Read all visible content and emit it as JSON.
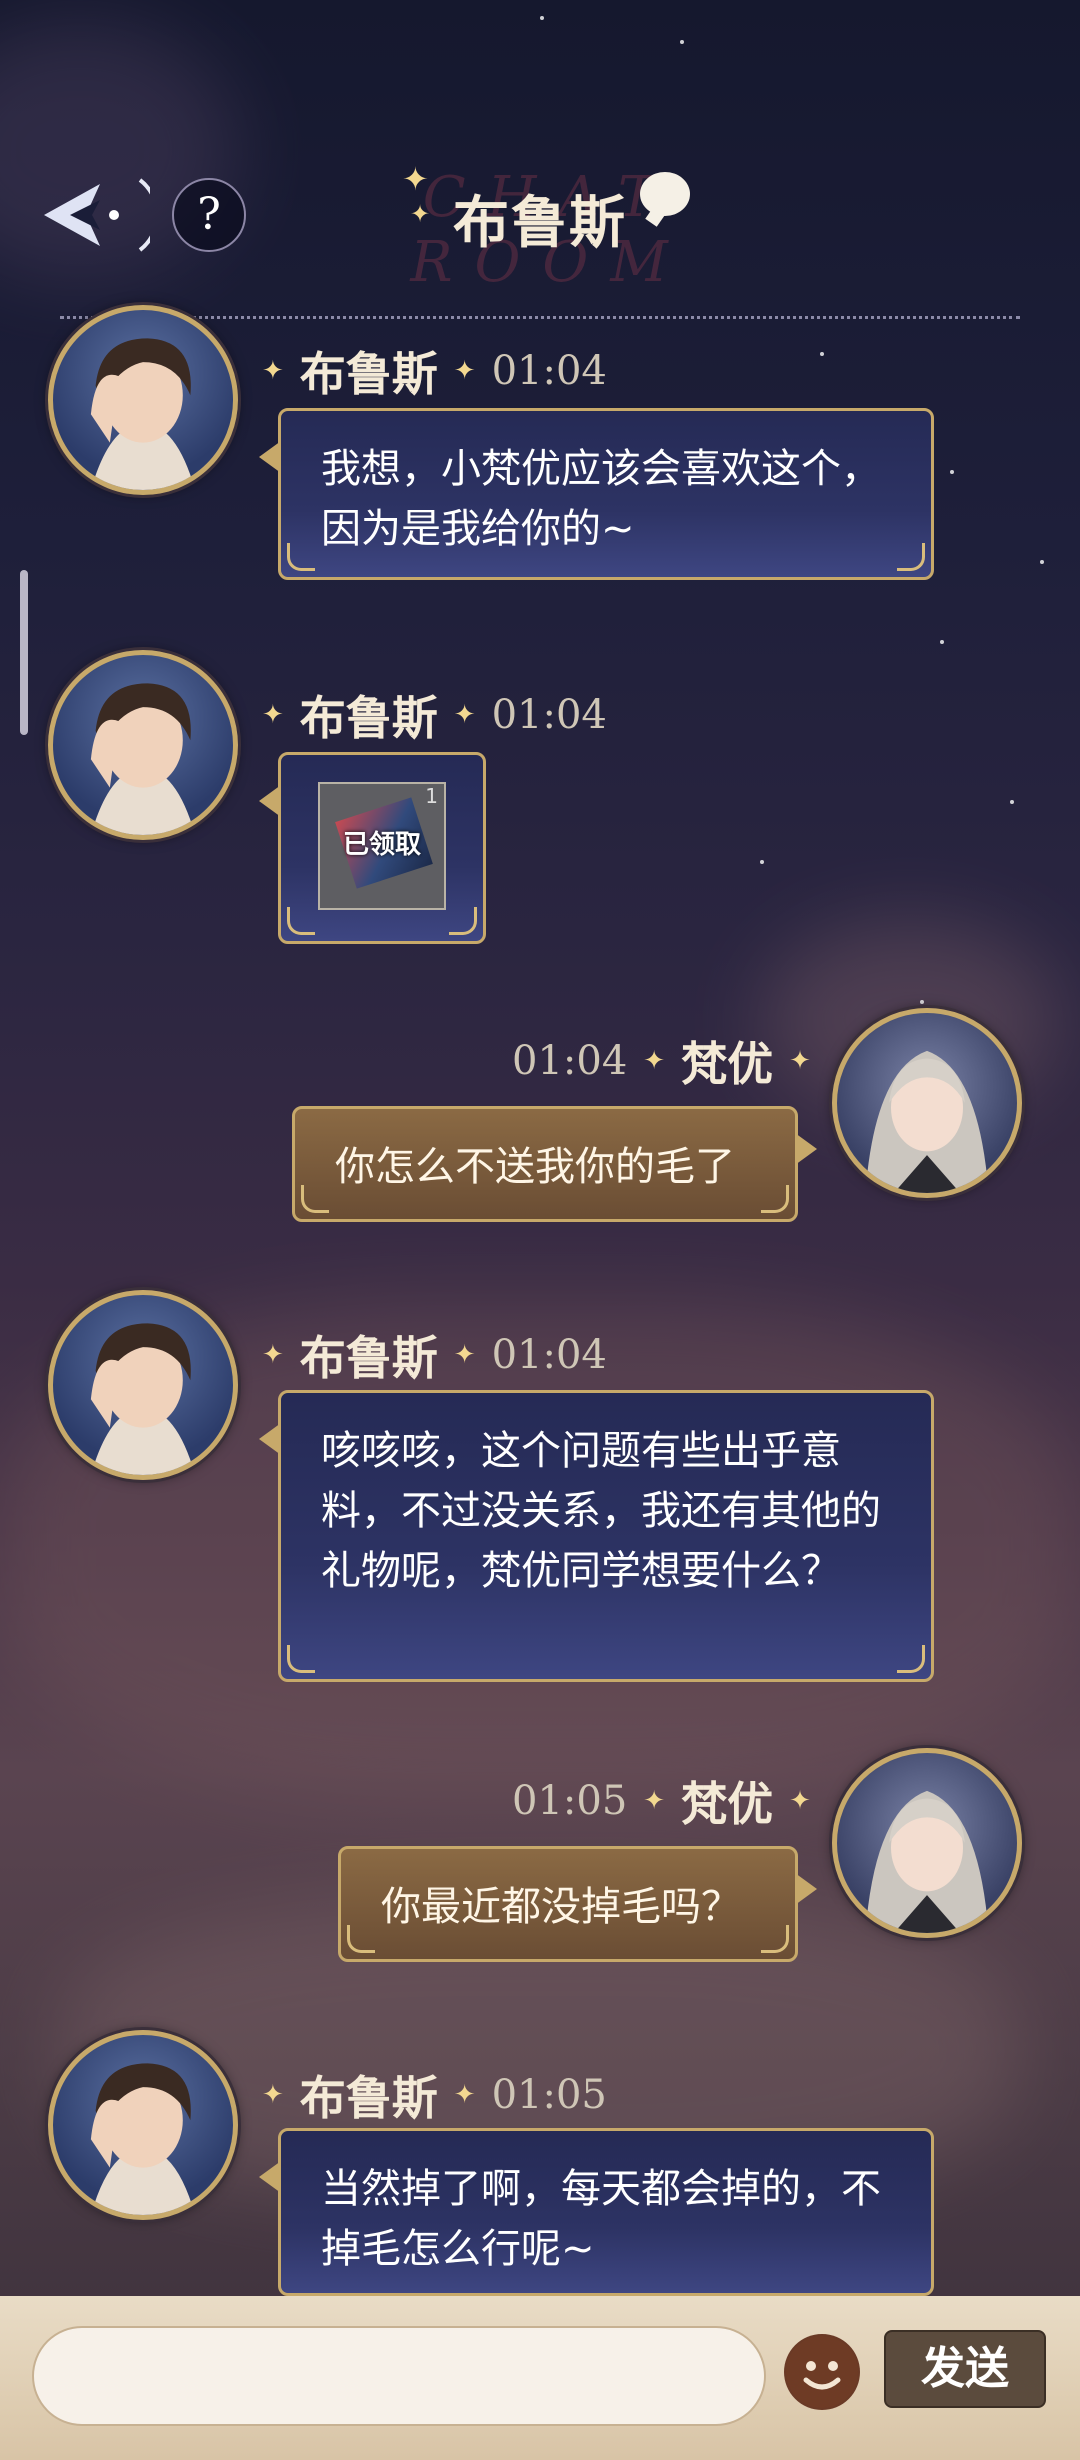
{
  "header": {
    "title": "布鲁斯",
    "watermark": "CHAT ROOM",
    "help_label": "?"
  },
  "messages": [
    {
      "sender": "布鲁斯",
      "time": "01:04",
      "side": "left",
      "text": "我想，小梵优应该会喜欢这个，因为是我给你的~"
    },
    {
      "sender": "布鲁斯",
      "time": "01:04",
      "side": "left",
      "gift": {
        "label": "已领取",
        "count": "1"
      }
    },
    {
      "sender": "梵优",
      "time": "01:04",
      "side": "right",
      "text": "你怎么不送我你的毛了"
    },
    {
      "sender": "布鲁斯",
      "time": "01:04",
      "side": "left",
      "text": "咳咳咳，这个问题有些出乎意料，不过没关系，我还有其他的礼物呢，梵优同学想要什么？"
    },
    {
      "sender": "梵优",
      "time": "01:05",
      "side": "right",
      "text": "你最近都没掉毛吗？"
    },
    {
      "sender": "布鲁斯",
      "time": "01:05",
      "side": "left",
      "text": "当然掉了啊，每天都会掉的，不掉毛怎么行呢~"
    }
  ],
  "input": {
    "placeholder": "",
    "send_label": "发送"
  },
  "colors": {
    "accent_gold": "#c7a96a",
    "incoming_bubble": "#2d3364",
    "outgoing_bubble": "#7a5a3c"
  }
}
